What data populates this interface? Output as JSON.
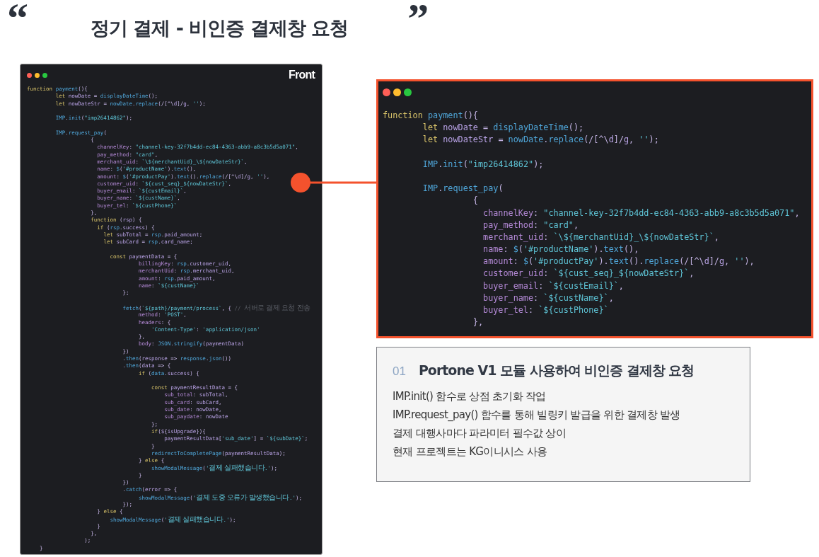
{
  "title": {
    "open_quote": "“",
    "text": "정기 결제 - 비인증 결제창 요청",
    "close_quote": "”"
  },
  "front_window": {
    "label": "Front",
    "blocks": [
      [
        "function payment(){",
        "         let nowDate = displayDateTime();",
        "         let nowDateStr = nowDate.replace(/[^\\d]/g, '');"
      ],
      [
        "         IMP.init(\"imp26414862\");"
      ],
      [
        "         IMP.request_pay(",
        "                    {",
        "                      channelKey: \"channel-key-32f7b4dd-ec84-4363-abb9-a8c3b5d5a071\",",
        "                      pay_method: \"card\",",
        "                      merchant_uid: `\\${merchantUid}_\\${nowDateStr}`,",
        "                      name: $('#productName').text(),",
        "                      amount: $('#productPay').text().replace(/[^\\d]/g, ''),",
        "                      customer_uid: `${cust_seq}_${nowDateStr}`,",
        "                      buyer_email: `${custEmail}`,",
        "                      buyer_name: `${custName}`,",
        "                      buyer_tel: `${custPhone}`",
        "                    },",
        "                    function (rsp) {",
        "                      if (rsp.success) {",
        "                        let subTotal = rsp.paid_amount;",
        "                        let subCard = rsp.card_name;"
      ],
      [
        "                          const paymentData = {",
        "                                   billingKey: rsp.customer_uid,",
        "                                   merchantUid: rsp.merchant_uid,",
        "                                   amount: rsp.paid_amount,",
        "                                   name: `${custName}`",
        "                              };"
      ],
      [
        "                              fetch(`${path}/payment/process`, { // 서버로 결제 요청 전송",
        "                                   method: 'POST',",
        "                                   headers: {",
        "                                       'Content-Type': 'application/json'",
        "                                   },",
        "                                   body: JSON.stringify(paymentData)",
        "                              })",
        "                              .then(response => response.json())",
        "                              .then(data => {",
        "                                   if (data.success) {"
      ],
      [
        "                                       const paymentResultData = {",
        "                                           sub_total: subTotal,",
        "                                           sub_card: subCard,",
        "                                           sub_date: nowDate,",
        "                                           sub_paydate: nowDate",
        "                                       };",
        "                                       if(${isUpgrade}){",
        "                                           paymentResultData['sub_date'] = `${subDate}`;",
        "                                       }",
        "                                       redirectToCompletePage(paymentResultData);",
        "                                   } else {",
        "                                       showModalMessage('결제 실패했습니다.');",
        "                                   }",
        "                              })",
        "                              .catch(error => {",
        "                                   showModalMessage('결제 도중 오류가 발생했습니다.');",
        "                              });",
        "                      } else {",
        "                          showModalMessage('결제 실패했습니다.');",
        "                      }",
        "                    },",
        "                  );",
        "    }"
      ]
    ]
  },
  "zoom_window": {
    "blocks": [
      [
        "function payment(){",
        "        let nowDate = displayDateTime();",
        "        let nowDateStr = nowDate.replace(/[^\\d]/g, '');"
      ],
      [
        "        IMP.init(\"imp26414862\");"
      ],
      [
        "        IMP.request_pay(",
        "                  {",
        "                    channelKey: \"channel-key-32f7b4dd-ec84-4363-abb9-a8c3b5d5a071\",",
        "                    pay_method: \"card\",",
        "                    merchant_uid: `\\${merchantUid}_\\${nowDateStr}`,",
        "                    name: $('#productName').text(),",
        "                    amount: $('#productPay').text().replace(/[^\\d]/g, ''),",
        "                    customer_uid: `${cust_seq}_${nowDateStr}`,",
        "                    buyer_email: `${custEmail}`,",
        "                    buyer_name: `${custName}`,",
        "                    buyer_tel: `${custPhone}`",
        "                  },"
      ]
    ]
  },
  "note": {
    "number": "01",
    "heading": "Portone V1 모듈 사용하여 비인증 결제창 요청",
    "lines": [
      "IMP.init() 함수로 상점 초기화 작업",
      "IMP.request_pay() 함수를 통해 빌링키 발급을 위한 결제창 발생",
      "결제 대행사마다 파라미터 필수값 상이",
      "현재 프로젝트는 KG이니시스 사용"
    ]
  }
}
